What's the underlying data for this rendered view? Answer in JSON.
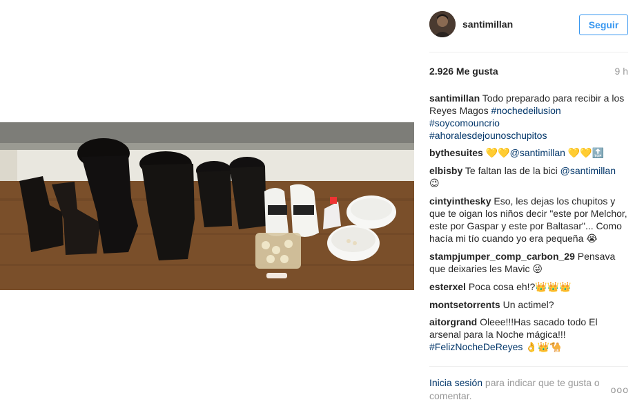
{
  "post": {
    "username": "santimillan",
    "follow_label": "Seguir",
    "likes": "2.926 Me gusta",
    "time": "9 h"
  },
  "comments": [
    {
      "user": "santimillan",
      "text": "Todo preparado para recibir a los Reyes Magos ",
      "tags": [
        "#nochedeilusion",
        "#soycomouncrio",
        "#ahoralesdejounoschupitos"
      ]
    },
    {
      "user": "bythesuites",
      "emoji_before": "💛💛",
      "mention": "@santimillan",
      "emoji_after": "💛💛🔝"
    },
    {
      "user": "elbisby",
      "text": "Te faltan las de la bici ",
      "mention": "@santimillan",
      "emoji": "😉"
    },
    {
      "user": "cintyinthesky",
      "text": "Eso, les dejas los chupitos y que te oigan los niños decir \"este por Melchor, este por Gaspar y este por Baltasar\"... Como hacía mi tío cuando yo era pequeña",
      "emoji": "😭"
    },
    {
      "user": "stampjumper_comp_carbon_29",
      "text": "Pensava que deixaries les Mavic",
      "emoji": "😜"
    },
    {
      "user": "esterxel",
      "text": "Poca cosa eh!?",
      "emoji": "👑👑👑"
    },
    {
      "user": "montsetorrents",
      "text": "Un actimel?"
    },
    {
      "user": "aitorgrand",
      "text": "Oleee!!!Has sacado todo El arsenal para la Noche mágica!!!",
      "tag": "#FelizNocheDeReyes",
      "emoji": "👌👑🐪"
    }
  ],
  "footer": {
    "login_label": "Inicia sesión",
    "rest": " para indicar que te gusta o comentar.",
    "more": "ooo"
  }
}
